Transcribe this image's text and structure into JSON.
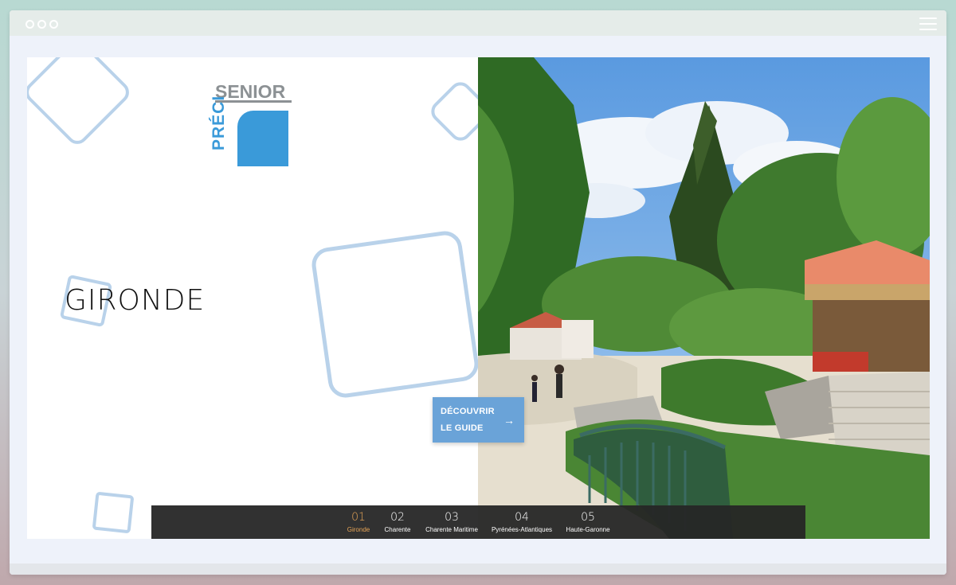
{
  "brand": {
    "logo_text_top": "SENIOR",
    "logo_text_side": "PRÉCI",
    "accent_color": "#3a9ad9",
    "logo_gray": "#8c9194"
  },
  "hero": {
    "region": "GIRONDE",
    "cta_line1": "DÉCOUVRIR",
    "cta_line2": "LE GUIDE",
    "cta_arrow_icon": "→"
  },
  "tabs": [
    {
      "number": "01",
      "label": "Gironde",
      "active": true
    },
    {
      "number": "02",
      "label": "Charente",
      "active": false
    },
    {
      "number": "03",
      "label": "Charente Maritime",
      "active": false
    },
    {
      "number": "04",
      "label": "Pyrénées-Atlantiques",
      "active": false
    },
    {
      "number": "05",
      "label": "Haute-Garonne",
      "active": false
    }
  ],
  "colors": {
    "active_tab": "#e7a557",
    "tab_bar": "#262626",
    "deco_squares": "#b9d2ea",
    "cta_bg": "#6aa3d8"
  },
  "icons": {
    "window_controls": [
      "window-dot-icon",
      "window-dot-icon",
      "window-dot-icon"
    ],
    "menu": "hamburger-menu-icon",
    "cta": "arrow-right-icon"
  }
}
